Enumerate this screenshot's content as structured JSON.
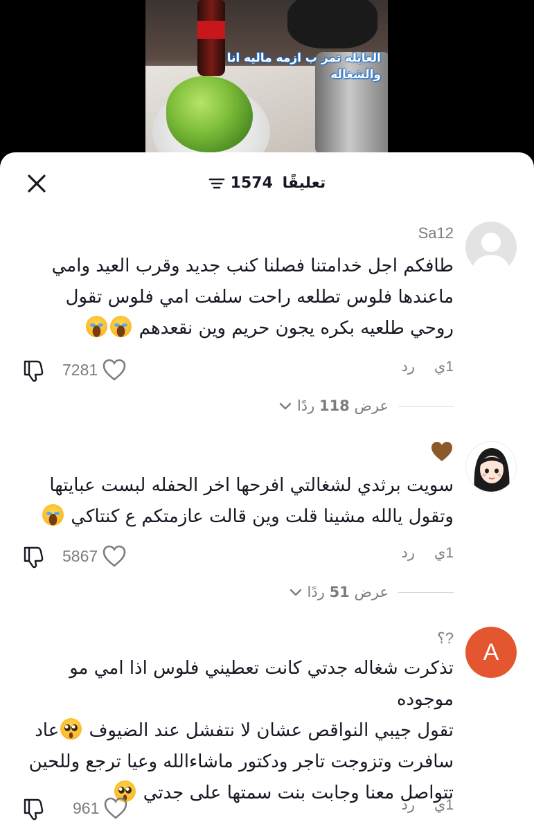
{
  "video": {
    "caption": "العايله تمر ب ازمه ماليه انا والشغاله"
  },
  "sheet": {
    "comment_count": "1574",
    "comment_count_label": "تعليقًا"
  },
  "comments": [
    {
      "username": "Sa12",
      "avatar": "default-avatar",
      "text": "طافكم اجل خدامتنا فصلنا كنب جديد وقرب العيد وامي ماعندها فلوس تطلعه راحت سلفت امي فلوس تقول روحي طلعيه بكره يجون حريم وين نقعدهم",
      "emoji": [
        "😂",
        "😂"
      ],
      "time": "1ي",
      "reply_label": "رد",
      "likes": "7281",
      "view_replies_prefix": "عرض",
      "view_replies_count": "118",
      "view_replies_suffix": "ردًا"
    },
    {
      "username": "🤎",
      "avatar": "cartoon-girl-avatar",
      "text": "سويت برثدي لشغالتي افرحها اخر الحفله لبست عبايتها وتقول يالله مشينا قلت وين قالت عازمتكم ع كنتاكي",
      "emoji": [
        "😂"
      ],
      "time": "1ي",
      "reply_label": "رد",
      "likes": "5867",
      "view_replies_prefix": "عرض",
      "view_replies_count": "51",
      "view_replies_suffix": "ردًا"
    },
    {
      "username": "?؟",
      "avatar": "A",
      "text_lines": [
        "تذكرت شغاله جدتي كانت تعطيني فلوس اذا امي مو موجوده",
        "تقول جيبي النواقص عشان لا نتفشل عند الضيوف",
        "عاد",
        "سافرت وتزوجت تاجر ودكتور ماشاءالله وعيا ترجع وللحين",
        "تتواصل معنا وجابت بنت سمتها على جدتي"
      ],
      "time": "1ي",
      "reply_label": "رد",
      "likes": "961"
    }
  ],
  "colors": {
    "accent_avatar": "#e4562f",
    "muted_text": "#7b7c80",
    "caption_stroke": "#1c6fc9"
  }
}
